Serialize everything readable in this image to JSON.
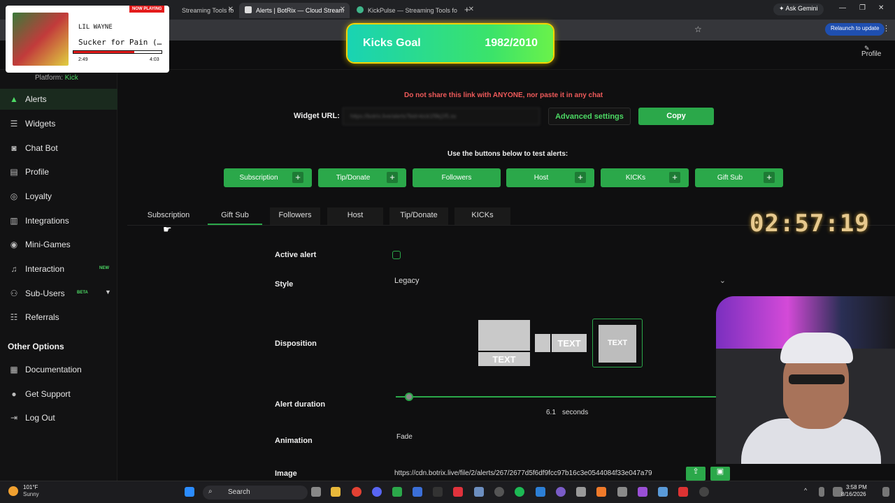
{
  "browser": {
    "tabs": [
      {
        "label": "Streaming Tools fo"
      },
      {
        "label": "Alerts | BotRix — Cloud Stream"
      },
      {
        "label": "KickPulse — Streaming Tools fo"
      }
    ],
    "new_tab": "+",
    "ask_gemini": "Ask Gemini",
    "relaunch": "Relaunch to update"
  },
  "header": {
    "profile": "Profile"
  },
  "now_playing": {
    "tag": "NOW PLAYING",
    "artist": "LIL WAYNE",
    "song": "Sucker for Pain (…",
    "elapsed": "2:49",
    "total": "4:03",
    "progress": 0.69
  },
  "kicks_goal": {
    "label": "Kicks Goal",
    "value": "1982/2010"
  },
  "sidebar": {
    "platform_label": "Platform:",
    "platform_value": "Kick",
    "items": [
      {
        "label": "Alerts"
      },
      {
        "label": "Widgets"
      },
      {
        "label": "Chat Bot"
      },
      {
        "label": "Profile"
      },
      {
        "label": "Loyalty"
      },
      {
        "label": "Integrations"
      },
      {
        "label": "Mini-Games"
      },
      {
        "label": "Interaction",
        "badge": "NEW"
      },
      {
        "label": "Sub-Users",
        "badge": "BETA"
      },
      {
        "label": "Referrals"
      }
    ],
    "other_title": "Other Options",
    "other_items": [
      {
        "label": "Documentation"
      },
      {
        "label": "Get Support"
      },
      {
        "label": "Log Out"
      }
    ]
  },
  "main": {
    "warning": "Do not share this link with ANYONE, nor paste it in any chat",
    "widget_label": "Widget URL:",
    "widget_url": "https://botrix.live/alerts?bid=kick1f9kj1f5.ss",
    "advanced": "Advanced settings",
    "copy": "Copy",
    "test_hint": "Use the buttons below to test alerts:",
    "test_buttons": [
      {
        "label": "Subscription"
      },
      {
        "label": "Tip/Donate"
      },
      {
        "label": "Followers"
      },
      {
        "label": "Host"
      },
      {
        "label": "KICKs"
      },
      {
        "label": "Gift Sub"
      }
    ],
    "alert_tabs": [
      {
        "label": "Subscription"
      },
      {
        "label": "Gift Sub"
      },
      {
        "label": "Followers"
      },
      {
        "label": "Host"
      },
      {
        "label": "Tip/Donate"
      },
      {
        "label": "KICKs"
      }
    ],
    "form": {
      "active_label": "Active alert",
      "style_label": "Style",
      "style_value": "Legacy",
      "disposition_label": "Disposition",
      "disposition_text": "TEXT",
      "duration_label": "Alert duration",
      "duration_value": "6.1",
      "duration_unit": "seconds",
      "animation_label": "Animation",
      "animation_value": "Fade",
      "image_label": "Image",
      "image_url": "https://cdn.botrix.live/file/2/alerts/267/2677d5f6df9fcc97b16c3e0544084f33e047a79"
    }
  },
  "timer": "02:57:19",
  "taskbar": {
    "weather_temp": "101°F",
    "weather_desc": "Sunny",
    "search": "Search",
    "time": "3:58 PM",
    "date": "8/16/2026"
  },
  "colors": {
    "accent": "#2ba84a",
    "warning": "#ef5a5a",
    "goal_border": "#f4d400"
  }
}
